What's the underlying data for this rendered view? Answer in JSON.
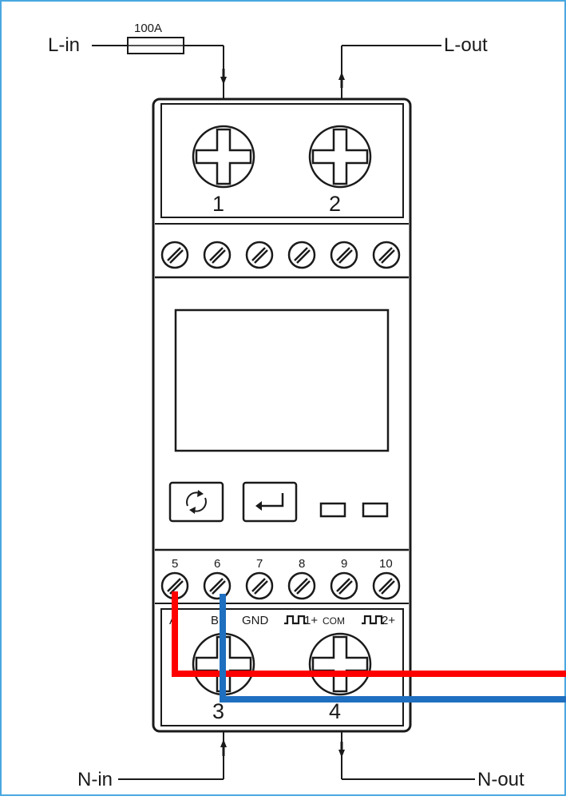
{
  "colors": {
    "frame_border": "#4aa8e0",
    "line": "#1a1a1a",
    "wire_a": "#ff0000",
    "wire_b": "#1f6fc0"
  },
  "labels": {
    "fuse": "100A",
    "l_in": "L-in",
    "l_out": "L-out",
    "n_in": "N-in",
    "n_out": "N-out"
  },
  "main_terminals": {
    "t1": "1",
    "t2": "2",
    "t3": "3",
    "t4": "4"
  },
  "signal_terminals": {
    "numbers": [
      "5",
      "6",
      "7",
      "8",
      "9",
      "10"
    ],
    "functions": [
      "A",
      "B",
      "GND",
      "1+",
      "COM",
      "2+"
    ]
  },
  "buttons": {
    "cycle": "cycle-icon",
    "enter": "enter-icon"
  },
  "wires": [
    {
      "name": "A",
      "color": "#ff0000"
    },
    {
      "name": "B",
      "color": "#1f6fc0"
    }
  ]
}
